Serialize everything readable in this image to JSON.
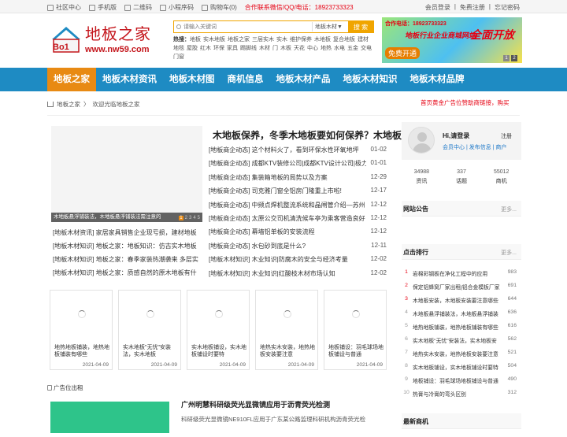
{
  "topbar": {
    "links": [
      {
        "label": "社区中心",
        "icon": "house-icon"
      },
      {
        "label": "手机版",
        "icon": "phone-icon"
      },
      {
        "label": "二维码",
        "icon": "qrcode-icon"
      },
      {
        "label": "小程序码",
        "icon": "miniapp-icon"
      },
      {
        "label": "购物车(0)",
        "icon": "cart-icon"
      }
    ],
    "hotline": "合作联系微信/QQ/电话：18923733323",
    "right": {
      "login": "会员登录",
      "sep": "|",
      "register": "免费注册",
      "forgot": "忘记密码"
    }
  },
  "logo": {
    "name": "地板之家",
    "badge": "Bo1",
    "url": "www.nw59.com"
  },
  "search": {
    "placeholder": "请输入关键词",
    "category": "地板木材▼",
    "button": "搜 索",
    "hot_label": "热搜：",
    "hot_words": [
      "地板",
      "实木地板",
      "地板之家",
      "三层实木",
      "实木",
      "维护保养",
      "木地板",
      "复合地板",
      "建材",
      "地毯",
      "屋胶",
      "红木",
      "环保",
      "家具",
      "踢脚线",
      "木材",
      "门",
      "木板",
      "天花",
      "中心",
      "地热",
      "水电",
      "五金",
      "交电",
      "门窗"
    ]
  },
  "banner": {
    "phone": "合作电话：18923733323",
    "line1": "地板行业企业商城网站",
    "line2": "全面开放",
    "line3": "免费开通"
  },
  "banner_pages": [
    "1",
    "2"
  ],
  "nav": [
    "地板之家",
    "地板木材资讯",
    "地板木材图",
    "商机信息",
    "地板木材产品",
    "地板木材知识",
    "地板木材品牌"
  ],
  "breadcrumb": {
    "home": "地板之家",
    "sep": "〉",
    "current": "欢迎光临地板之家"
  },
  "notice": "首页黄金广告位赞助商链接，购买",
  "slider": {
    "caption": "木地板悬浮铺装法，木地板悬浮铺装法需注意的",
    "pages": [
      "1",
      "2",
      "3",
      "4",
      "5"
    ]
  },
  "headline": "木地板保养，冬季木地板要如何保养？木地板",
  "news": [
    {
      "text": "[地板商企动态] 这个材料火了，看到环保水性环氧地坪",
      "date": "01-02"
    },
    {
      "text": "[地板商企动态] 成都KTV装修公司|成都KTV设计公司|极力",
      "date": "01-01"
    },
    {
      "text": "[地板商企动态] 集装箱地板的局势以及方案",
      "date": "12-29"
    },
    {
      "text": "[地板商企动态] 司克雅门窗全铝房门隆重上市啦!",
      "date": "12-17"
    },
    {
      "text": "[地板商企动态] 中频点焊机整流系统和晶闸管介绍—苏州",
      "date": "12-12"
    },
    {
      "text": "[地板商企动态] 太原公交司机清洗候车亭为乘客营造良好",
      "date": "12-12"
    },
    {
      "text": "[地板商企动态] 幕墙铝单板的安装流程",
      "date": "12-12"
    },
    {
      "text": "[地板商企动态] 水包砂到底是什么?",
      "date": "12-11"
    },
    {
      "text": "[地板木材知识] 木业知识|防腐木的安全与经济考量",
      "date": "12-02"
    },
    {
      "text": "[地板木材知识] 木业知识|红酸枝木材市场认知",
      "date": "12-02"
    }
  ],
  "left_news": [
    "[地板木材资讯] 家居家具销售企业现亏损，建材地板",
    "[地板木材知识] 地板之家：地板知识：仿古实木地板",
    "[地板木材知识] 地板之家：春季家装热潮袭来 多层实",
    "[地板木材知识] 地板之家：质感自然的原木地板有什"
  ],
  "cards": [
    {
      "title": "地热地板铺装，地热地板铺装有哪些",
      "date": "2021-04-09"
    },
    {
      "title": "实木地板\"无忧\"安装法，实木地板",
      "date": "2021-04-09"
    },
    {
      "title": "实木地板铺设，实木地板铺设时要特",
      "date": "2021-04-09"
    },
    {
      "title": "地热实木安装，地热地板安装要注意",
      "date": "2021-04-09"
    },
    {
      "title": "地板铺设：羽毛球场地板铺设与普通",
      "date": "2021-04-09"
    }
  ],
  "ad": {
    "label": "广告位出租",
    "title": "广州明慧科研级荧光显微镜应用于沥青荧光检测",
    "desc": "科研级荧光显微镜NE910FL应用于广东某公路监理科研机构沥青荧光检"
  },
  "side": {
    "greeting": "Hi,请登录",
    "register": "注册",
    "links": "会员中心 | 发布信息 | 商户",
    "stats": [
      {
        "value": "34988",
        "label": "资讯"
      },
      {
        "value": "337",
        "label": "话题"
      },
      {
        "value": "55012",
        "label": "商机"
      }
    ],
    "notice_title": "网站公告",
    "more": "更多...",
    "rank_title": "点击排行",
    "ranks": [
      {
        "n": "1",
        "t": "岩棉彩钢板在净化工程中的应用",
        "c": "983"
      },
      {
        "n": "2",
        "t": "保定铝蜂窝厂家出租|铝合金模板厂家",
        "c": "691"
      },
      {
        "n": "3",
        "t": "木地板安装，木地板安装要注意哪些",
        "c": "644"
      },
      {
        "n": "4",
        "t": "木地板悬浮铺装法，木地板悬浮铺装",
        "c": "636"
      },
      {
        "n": "5",
        "t": "地热地板铺装，地热地板铺装有哪些",
        "c": "616"
      },
      {
        "n": "6",
        "t": "实木地板\"无忧\"安装法，实木地板安",
        "c": "562"
      },
      {
        "n": "7",
        "t": "地热实木安装，地热地板安装要注意",
        "c": "521"
      },
      {
        "n": "8",
        "t": "实木地板铺设，实木地板铺设时要特",
        "c": "504"
      },
      {
        "n": "9",
        "t": "地板铺设：羽毛球场地板铺设与普通",
        "c": "490"
      },
      {
        "n": "10",
        "t": "热膏与冷膏的弯头区别",
        "c": "312"
      }
    ],
    "biz_title": "最新商机"
  }
}
